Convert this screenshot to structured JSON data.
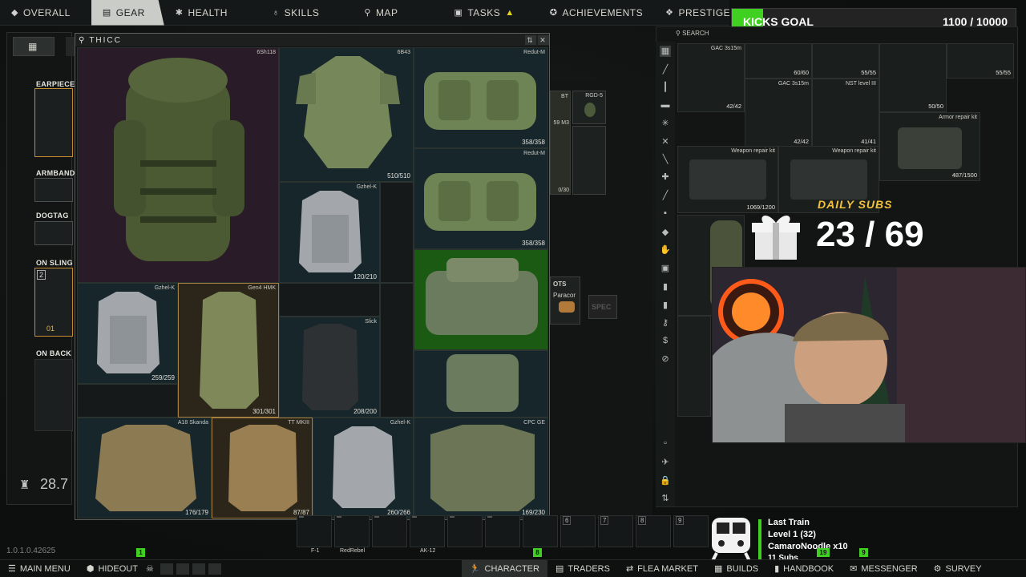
{
  "nav": {
    "tabs": [
      {
        "label": "OVERALL",
        "icon": "diamond-icon"
      },
      {
        "label": "GEAR",
        "icon": "shirt-icon"
      },
      {
        "label": "HEALTH",
        "icon": "health-icon"
      },
      {
        "label": "SKILLS",
        "icon": "skills-icon"
      },
      {
        "label": "MAP",
        "icon": "map-pin-icon"
      },
      {
        "label": "TASKS",
        "icon": "tasks-icon"
      },
      {
        "label": "ACHIEVEMENTS",
        "icon": "achievements-icon"
      },
      {
        "label": "PRESTIGE",
        "icon": "prestige-icon"
      }
    ]
  },
  "kicks_goal": {
    "label": "KICKS GOAL",
    "value": "1100 / 10000",
    "progress": 0.11
  },
  "equipment": {
    "slots": [
      "EARPIECE",
      "ARMBAND",
      "DOGTAG",
      "ON SLING",
      "ON BACK"
    ],
    "sling_count": "2",
    "sling_level": "01",
    "weight": "28.7"
  },
  "container": {
    "title": "THICC",
    "items": [
      {
        "name": "6Sh118",
        "durability": ""
      },
      {
        "name": "6B43",
        "durability": "510/510"
      },
      {
        "name": "Redut-M",
        "durability": "358/358"
      },
      {
        "name": "Redut-M",
        "durability": "358/358"
      },
      {
        "name": "Gzhel-K",
        "durability": "120/210"
      },
      {
        "name": "Gzhel-K",
        "durability": "259/259"
      },
      {
        "name": "Gen4 HMK",
        "durability": "301/301"
      },
      {
        "name": "Slick",
        "durability": "208/200"
      },
      {
        "name": "A18 Skanda",
        "durability": "176/179"
      },
      {
        "name": "TT MKIII",
        "durability": "87/87"
      },
      {
        "name": "Gzhel-K",
        "durability": "260/266"
      },
      {
        "name": "CPC GE",
        "durability": "169/230"
      }
    ]
  },
  "mid_items": {
    "bt": "BT",
    "rgd5": "RGD-5",
    "m3": "59 M3",
    "dur": "0/30",
    "ots": "OTS",
    "paracord": "Paracor"
  },
  "stash": {
    "search": "SEARCH",
    "items": [
      {
        "name": "GAC 3s15m",
        "durability": "60/60"
      },
      {
        "name": "",
        "durability": "55/55"
      },
      {
        "name": "",
        "durability": "55/55"
      },
      {
        "name": "",
        "durability": "42/42"
      },
      {
        "name": "GAC 3s15m",
        "durability": "42/42"
      },
      {
        "name": "NST level III",
        "durability": "41/41"
      },
      {
        "name": "",
        "durability": "50/50"
      },
      {
        "name": "Armor repair kit",
        "durability": "487/1500"
      },
      {
        "name": "Weapon repair kit",
        "durability": "1069/1200"
      },
      {
        "name": "Weapon repair kit",
        "durability": ""
      }
    ]
  },
  "daily_subs": {
    "label": "DAILY SUBS",
    "value": "23 / 69"
  },
  "hotbar": {
    "slots": [
      "",
      "",
      "",
      "",
      "",
      "",
      "6",
      "7",
      "8",
      "9"
    ],
    "labels": {
      "f1": "F-1",
      "redrebel": "RedRebel",
      "ak12": "AK-12"
    }
  },
  "last_train": {
    "title": "Last Train",
    "level": "Level 1  (32)",
    "user": "CamaroNoodle x10",
    "subs": "11 Subs"
  },
  "version": "1.0.1.0.42625",
  "bottom": {
    "items": [
      {
        "label": "MAIN MENU",
        "icon": "menu-icon"
      },
      {
        "label": "HIDEOUT",
        "icon": "hideout-icon"
      },
      {
        "label": "CHARACTER",
        "icon": "character-icon"
      },
      {
        "label": "TRADERS",
        "icon": "traders-icon"
      },
      {
        "label": "FLEA MARKET",
        "icon": "flea-icon"
      },
      {
        "label": "BUILDS",
        "icon": "builds-icon"
      },
      {
        "label": "HANDBOOK",
        "icon": "handbook-icon"
      },
      {
        "label": "MESSENGER",
        "icon": "messenger-icon"
      },
      {
        "label": "SURVEY",
        "icon": "survey-icon"
      }
    ],
    "badges": {
      "one": "1",
      "eight": "8",
      "nineteen": "19",
      "nine": "9"
    }
  },
  "colors": {
    "accent_green": "#40d022",
    "gold": "#f4c23a",
    "bg": "#0b0d0d"
  }
}
